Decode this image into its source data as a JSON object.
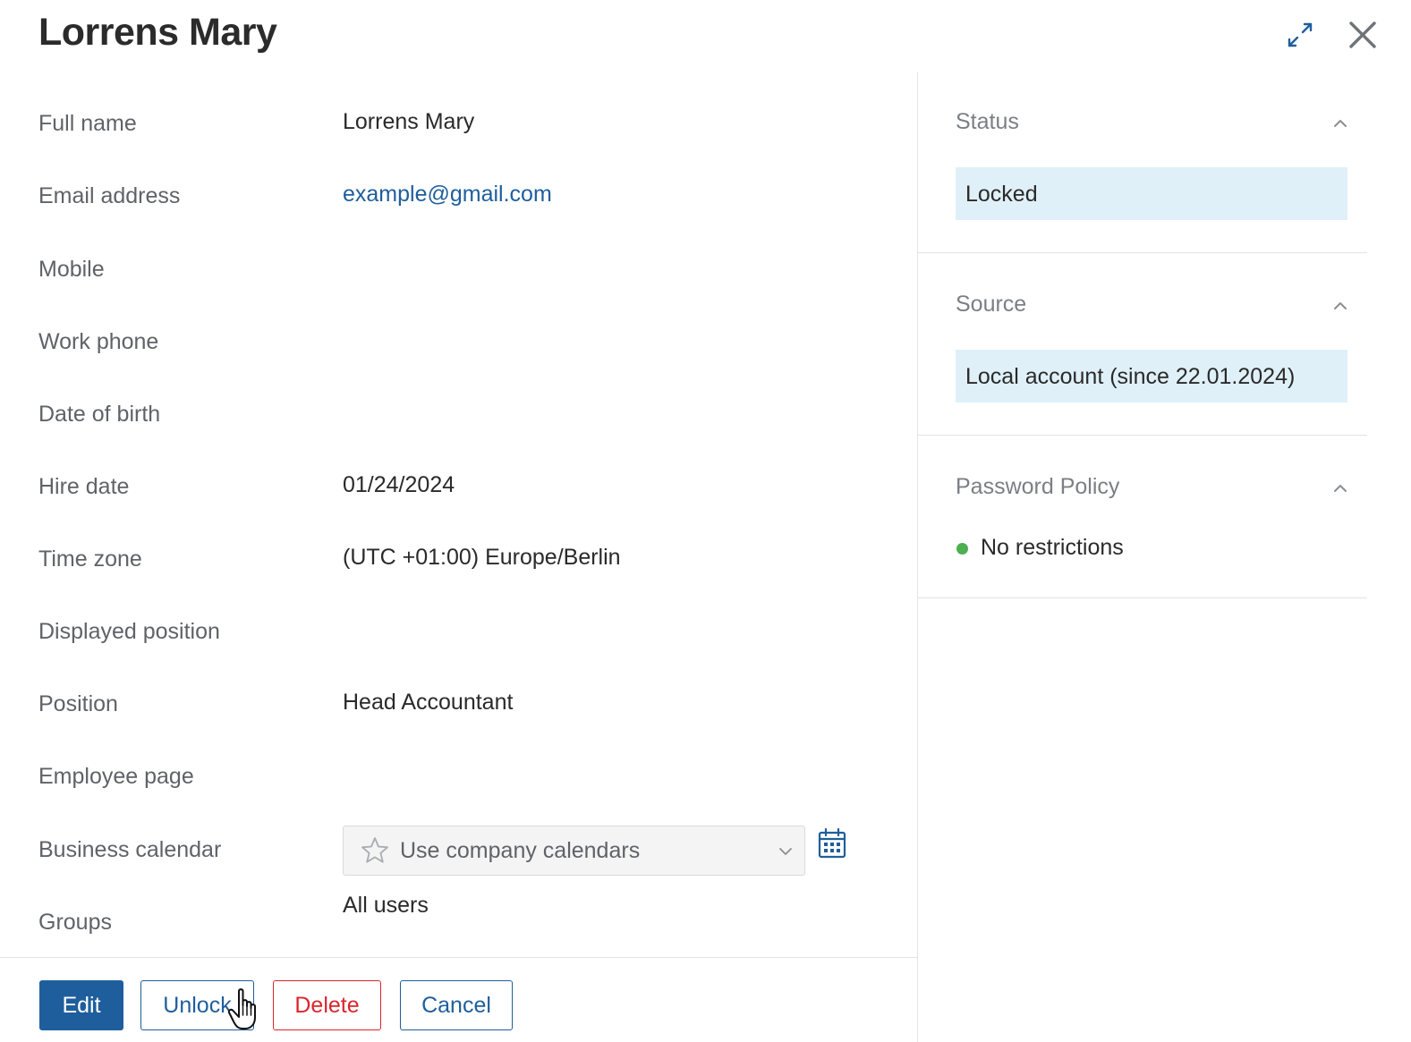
{
  "header": {
    "title": "Lorrens Mary",
    "expand_icon": "expand-arrows-icon",
    "close_icon": "close-icon"
  },
  "fields": [
    {
      "label": "Full name",
      "value": "Lorrens Mary"
    },
    {
      "label": "Email address",
      "value": "example@gmail.com"
    },
    {
      "label": "Mobile",
      "value": ""
    },
    {
      "label": "Work phone",
      "value": ""
    },
    {
      "label": "Date of birth",
      "value": ""
    },
    {
      "label": "Hire date",
      "value": "01/24/2024"
    },
    {
      "label": "Time zone",
      "value": "(UTC +01:00) Europe/Berlin"
    },
    {
      "label": "Displayed position",
      "value": ""
    },
    {
      "label": "Position",
      "value": "Head Accountant"
    },
    {
      "label": "Employee page",
      "value": ""
    },
    {
      "label": "Business calendar",
      "value": "Use company calendars"
    },
    {
      "label": "Groups",
      "value": "All users"
    }
  ],
  "sidebar": {
    "status": {
      "title": "Status",
      "value": "Locked"
    },
    "source": {
      "title": "Source",
      "value": "Local account (since 22.01.2024)"
    },
    "password_policy": {
      "title": "Password Policy",
      "value": "No restrictions",
      "indicator_color": "#4caf50"
    }
  },
  "buttons": {
    "edit": "Edit",
    "unlock": "Unlock",
    "delete": "Delete",
    "cancel": "Cancel"
  },
  "colors": {
    "accent": "#1f5e9c",
    "danger": "#d9252c",
    "highlight_bg": "#dff0f8"
  }
}
